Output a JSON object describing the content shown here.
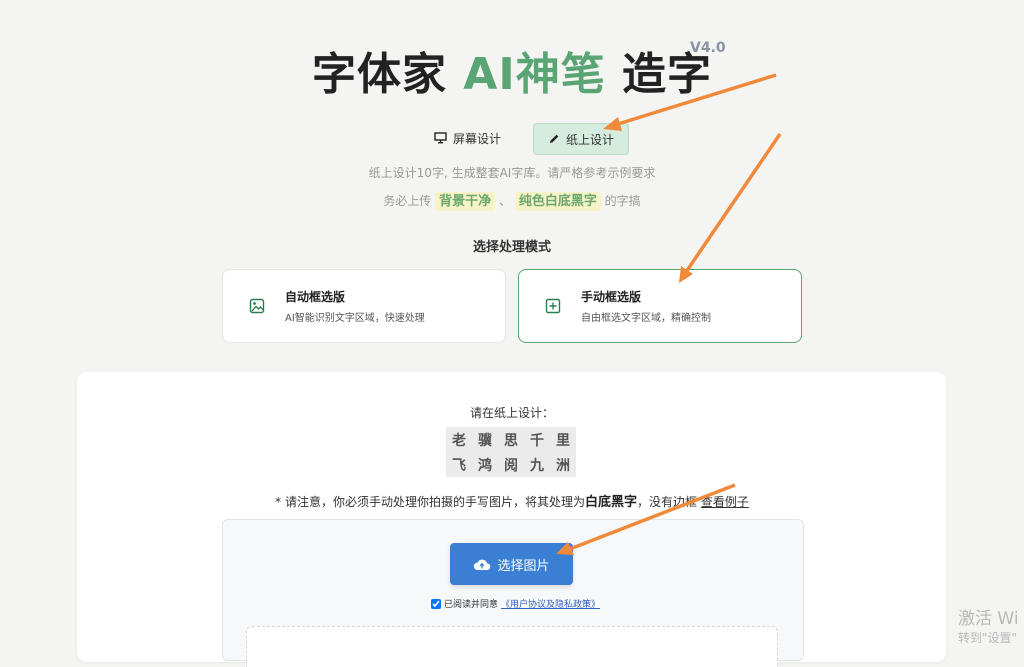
{
  "header": {
    "title_part1": "字体家 ",
    "title_part2": "AI神笔",
    "title_part3": " 造字",
    "version": "V4.0"
  },
  "mode_tabs": [
    {
      "label": "屏幕设计",
      "icon": "monitor-icon",
      "active": false
    },
    {
      "label": "纸上设计",
      "icon": "pencil-icon",
      "active": true
    }
  ],
  "hints": {
    "line1": "纸上设计10字, 生成整套AI字库。请严格参考示例要求",
    "line2_prefix": "务必上传",
    "highlight1": "背景干净",
    "separator": "、",
    "highlight2": "纯色白底黑字",
    "line2_suffix": "的字搞"
  },
  "process_mode": {
    "title": "选择处理模式",
    "options": [
      {
        "title": "自动框选版",
        "desc": "AI智能识别文字区域，快速处理",
        "icon": "image-icon",
        "selected": false
      },
      {
        "title": "手动框选版",
        "desc": "自由框选文字区域，精确控制",
        "icon": "plus-square-icon",
        "selected": true
      }
    ]
  },
  "design_panel": {
    "prompt": "请在纸上设计：",
    "sample_chars": [
      "老",
      "骥",
      "思",
      "千",
      "里",
      "飞",
      "鸿",
      "阅",
      "九",
      "洲"
    ],
    "notice_prefix": "* 请注意，你必须手动处理你拍摄的手写图片，将其处理为",
    "notice_bold": "白底黑字",
    "notice_suffix": "，没有边框",
    "notice_link": "查看例子"
  },
  "upload": {
    "button_label": "选择图片",
    "agree_text": "已阅读并同意",
    "agree_link": "《用户协议及隐私政策》",
    "agree_checked": true
  },
  "watermark": {
    "line1": "激活 Wi",
    "line2": "转到\"设置\""
  },
  "colors": {
    "accent_green": "#5aa574",
    "button_blue": "#3b7fd4",
    "arrow_orange": "#f08a3a"
  }
}
